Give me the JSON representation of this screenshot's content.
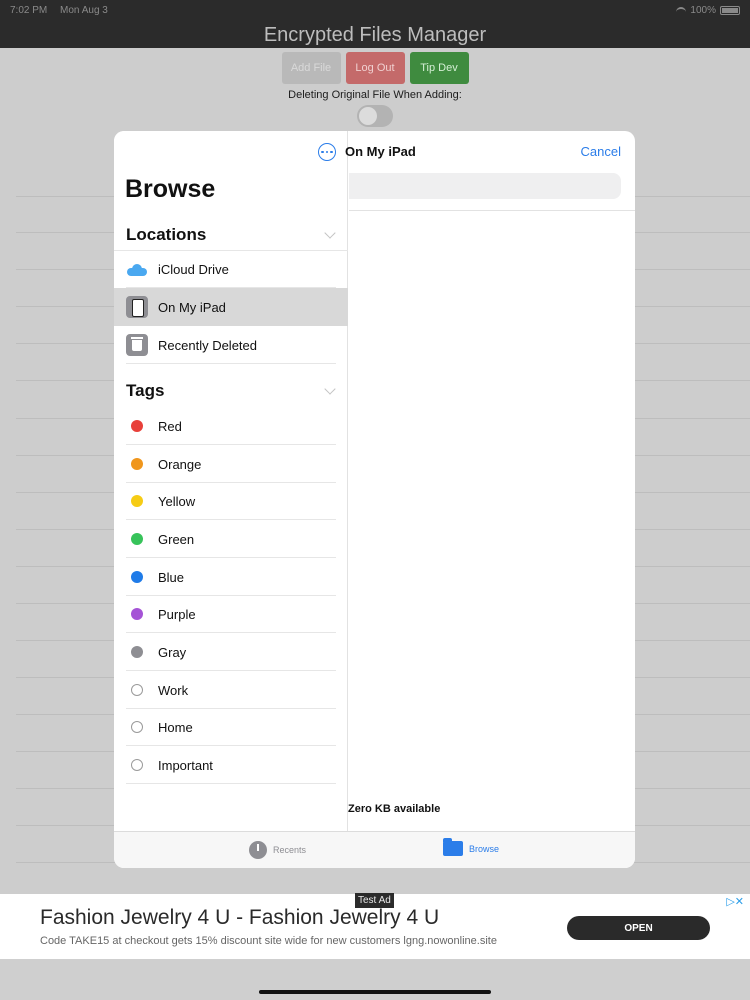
{
  "status": {
    "time": "7:02 PM",
    "date": "Mon Aug 3",
    "battery": "100%"
  },
  "app": {
    "title": "Encrypted Files Manager",
    "buttons": {
      "add": "Add File",
      "logout": "Log Out",
      "tip": "Tip Dev"
    },
    "delete_label": "Deleting Original File When Adding:"
  },
  "picker": {
    "browse_title": "Browse",
    "locations_header": "Locations",
    "locations": [
      {
        "label": "iCloud Drive",
        "icon": "icloud-icon"
      },
      {
        "label": "On My iPad",
        "icon": "ipad-icon",
        "selected": true
      },
      {
        "label": "Recently Deleted",
        "icon": "trash-icon"
      }
    ],
    "tags_header": "Tags",
    "tags": [
      {
        "label": "Red",
        "color": "#e8403a"
      },
      {
        "label": "Orange",
        "color": "#f0961c"
      },
      {
        "label": "Yellow",
        "color": "#f6cc15"
      },
      {
        "label": "Green",
        "color": "#37c35a"
      },
      {
        "label": "Blue",
        "color": "#1f7be8"
      },
      {
        "label": "Purple",
        "color": "#a553d6"
      },
      {
        "label": "Gray",
        "color": "#8e8e93"
      },
      {
        "label": "Work",
        "color": ""
      },
      {
        "label": "Home",
        "color": ""
      },
      {
        "label": "Important",
        "color": ""
      }
    ],
    "location_title": "On My iPad",
    "cancel": "Cancel",
    "available": "Zero KB available",
    "tabs": {
      "recents": "Recents",
      "browse": "Browse"
    }
  },
  "ad": {
    "badge": "Test Ad",
    "title": "Fashion Jewelry 4 U - Fashion Jewelry 4 U",
    "subtitle": "Code TAKE15 at checkout gets 15% discount site wide for new customers lgng.nowonline.site",
    "cta": "OPEN"
  },
  "colors": {
    "accent": "#2b7de9"
  }
}
